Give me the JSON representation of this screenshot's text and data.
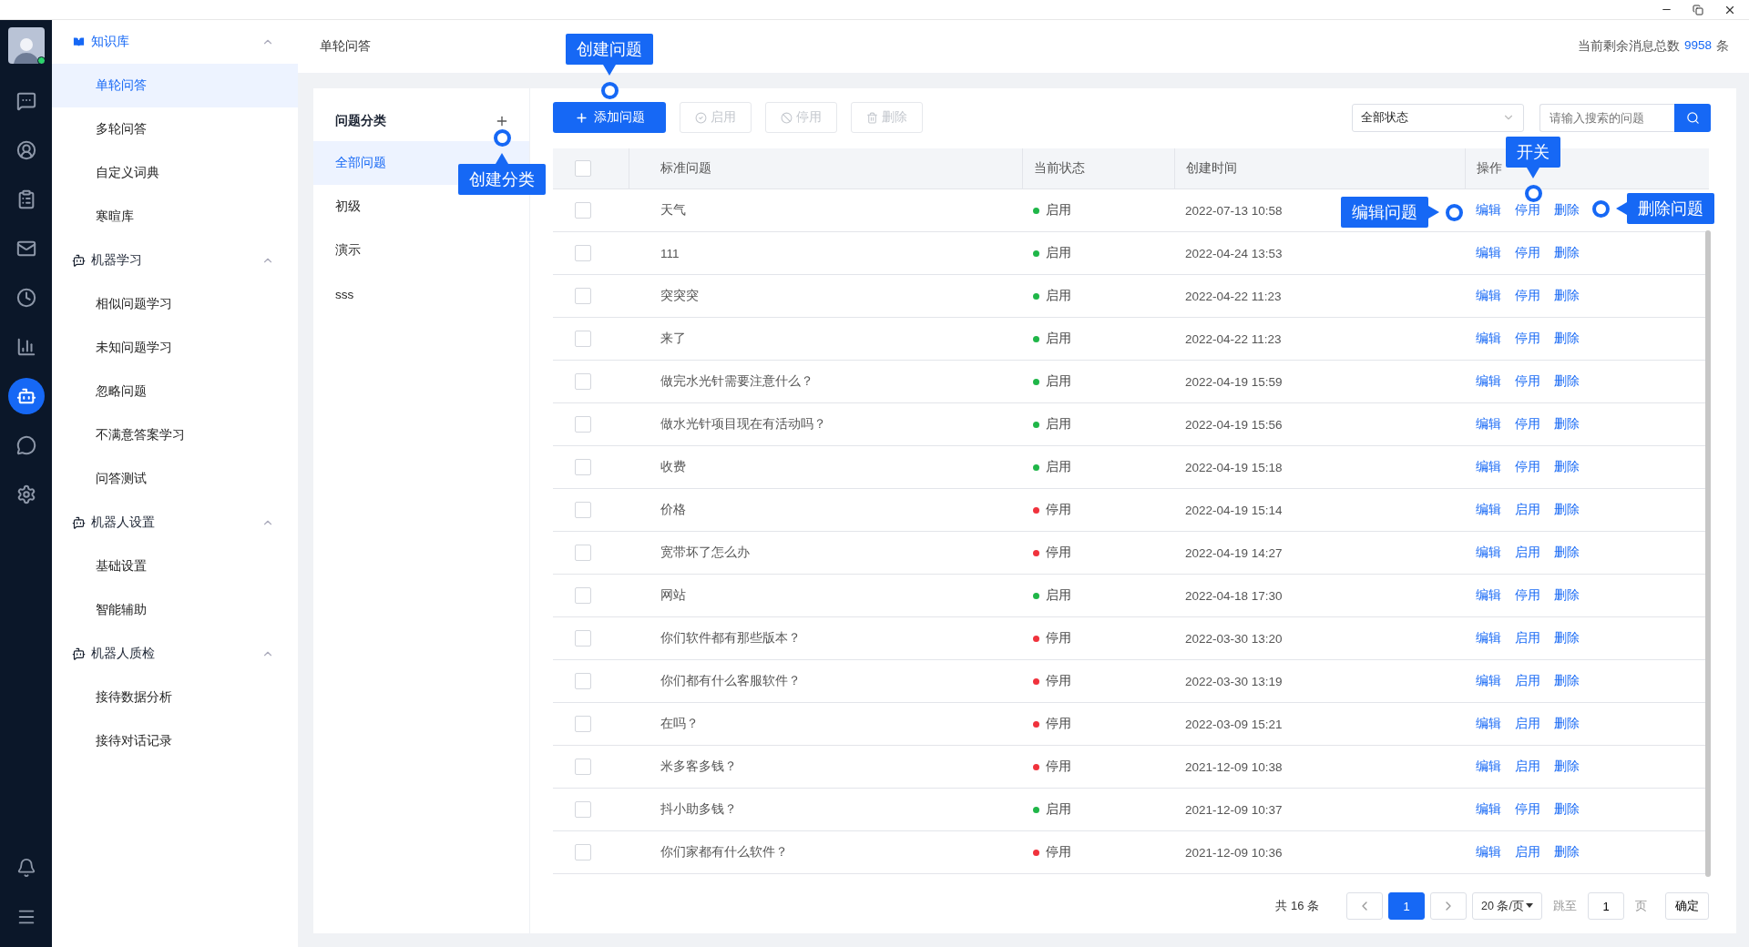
{
  "rail": {
    "items": [
      {
        "kind": "chat",
        "selected": false
      },
      {
        "kind": "user",
        "selected": false
      },
      {
        "kind": "clipboard",
        "selected": false
      },
      {
        "kind": "mail",
        "selected": false
      },
      {
        "kind": "clock",
        "selected": false
      },
      {
        "kind": "chart",
        "selected": false
      },
      {
        "kind": "robot",
        "selected": true
      },
      {
        "kind": "wechat",
        "selected": false
      },
      {
        "kind": "gear",
        "selected": false
      }
    ],
    "bottom": [
      {
        "kind": "bell"
      },
      {
        "kind": "menu"
      }
    ]
  },
  "menu": {
    "groups": [
      {
        "label": "知识库",
        "kind": "book",
        "active": true,
        "expanded": true,
        "items": [
          {
            "label": "单轮问答",
            "selected": true
          },
          {
            "label": "多轮问答",
            "selected": false
          },
          {
            "label": "自定义词典",
            "selected": false
          },
          {
            "label": "寒暄库",
            "selected": false
          }
        ]
      },
      {
        "label": "机器学习",
        "kind": "robot",
        "active": false,
        "expanded": true,
        "items": [
          {
            "label": "相似问题学习",
            "selected": false
          },
          {
            "label": "未知问题学习",
            "selected": false
          },
          {
            "label": "忽略问题",
            "selected": false
          },
          {
            "label": "不满意答案学习",
            "selected": false
          },
          {
            "label": "问答测试",
            "selected": false
          }
        ]
      },
      {
        "label": "机器人设置",
        "kind": "robot",
        "active": false,
        "expanded": true,
        "items": [
          {
            "label": "基础设置",
            "selected": false
          },
          {
            "label": "智能辅助",
            "selected": false
          }
        ]
      },
      {
        "label": "机器人质检",
        "kind": "robot",
        "active": false,
        "expanded": true,
        "items": [
          {
            "label": "接待数据分析",
            "selected": false
          },
          {
            "label": "接待对话记录",
            "selected": false
          }
        ]
      }
    ]
  },
  "header": {
    "title": "单轮问答",
    "counter_label": "当前剩余消息总数",
    "counter_value": "9958",
    "counter_unit": "条"
  },
  "categories": {
    "title": "问题分类",
    "items": [
      {
        "label": "全部问题",
        "selected": true
      },
      {
        "label": "初级",
        "selected": false
      },
      {
        "label": "演示",
        "selected": false
      },
      {
        "label": "sss",
        "selected": false
      }
    ]
  },
  "toolbar": {
    "add": "添加问题",
    "actions": [
      {
        "label": "启用",
        "kind": "enable",
        "disabled": true
      },
      {
        "label": "停用",
        "kind": "disable",
        "disabled": true
      },
      {
        "label": "删除",
        "kind": "delete",
        "disabled": true
      }
    ],
    "status_filter": "全部状态",
    "search": {
      "placeholder": "请输入搜索的问题"
    }
  },
  "table": {
    "all_checked": false,
    "columns": [
      "标准问题",
      "当前状态",
      "创建时间",
      "操作"
    ],
    "rows": [
      {
        "checked": false,
        "question": "天气",
        "status": "启用",
        "enabled": true,
        "created": "2022-07-13 10:58",
        "actions": [
          "编辑",
          "停用",
          "删除"
        ]
      },
      {
        "checked": false,
        "question": "111",
        "status": "启用",
        "enabled": true,
        "created": "2022-04-24 13:53",
        "actions": [
          "编辑",
          "停用",
          "删除"
        ]
      },
      {
        "checked": false,
        "question": "突突突",
        "status": "启用",
        "enabled": true,
        "created": "2022-04-22 11:23",
        "actions": [
          "编辑",
          "停用",
          "删除"
        ]
      },
      {
        "checked": false,
        "question": "来了",
        "status": "启用",
        "enabled": true,
        "created": "2022-04-22 11:23",
        "actions": [
          "编辑",
          "停用",
          "删除"
        ]
      },
      {
        "checked": false,
        "question": "做完水光针需要注意什么？",
        "status": "启用",
        "enabled": true,
        "created": "2022-04-19 15:59",
        "actions": [
          "编辑",
          "停用",
          "删除"
        ]
      },
      {
        "checked": false,
        "question": "做水光针项目现在有活动吗？",
        "status": "启用",
        "enabled": true,
        "created": "2022-04-19 15:56",
        "actions": [
          "编辑",
          "停用",
          "删除"
        ]
      },
      {
        "checked": false,
        "question": "收费",
        "status": "启用",
        "enabled": true,
        "created": "2022-04-19 15:18",
        "actions": [
          "编辑",
          "停用",
          "删除"
        ]
      },
      {
        "checked": false,
        "question": "价格",
        "status": "停用",
        "enabled": false,
        "created": "2022-04-19 15:14",
        "actions": [
          "编辑",
          "启用",
          "删除"
        ]
      },
      {
        "checked": false,
        "question": "宽带坏了怎么办",
        "status": "停用",
        "enabled": false,
        "created": "2022-04-19 14:27",
        "actions": [
          "编辑",
          "启用",
          "删除"
        ]
      },
      {
        "checked": false,
        "question": "网站",
        "status": "启用",
        "enabled": true,
        "created": "2022-04-18 17:30",
        "actions": [
          "编辑",
          "停用",
          "删除"
        ]
      },
      {
        "checked": false,
        "question": "你们软件都有那些版本？",
        "status": "停用",
        "enabled": false,
        "created": "2022-03-30 13:20",
        "actions": [
          "编辑",
          "启用",
          "删除"
        ]
      },
      {
        "checked": false,
        "question": "你们都有什么客服软件？",
        "status": "停用",
        "enabled": false,
        "created": "2022-03-30 13:19",
        "actions": [
          "编辑",
          "启用",
          "删除"
        ]
      },
      {
        "checked": false,
        "question": "在吗？",
        "status": "停用",
        "enabled": false,
        "created": "2022-03-09 15:21",
        "actions": [
          "编辑",
          "启用",
          "删除"
        ]
      },
      {
        "checked": false,
        "question": "米多客多钱？",
        "status": "停用",
        "enabled": false,
        "created": "2021-12-09 10:38",
        "actions": [
          "编辑",
          "启用",
          "删除"
        ]
      },
      {
        "checked": false,
        "question": "抖小助多钱？",
        "status": "启用",
        "enabled": true,
        "created": "2021-12-09 10:37",
        "actions": [
          "编辑",
          "停用",
          "删除"
        ]
      },
      {
        "checked": false,
        "question": "你们家都有什么软件？",
        "status": "停用",
        "enabled": false,
        "created": "2021-12-09 10:36",
        "actions": [
          "编辑",
          "启用",
          "删除"
        ]
      }
    ]
  },
  "pagination": {
    "total": "共 16 条",
    "pages": [
      {
        "label": "1",
        "selected": true
      }
    ],
    "page_size": "20 条/页",
    "jump_label": "跳至",
    "jump_value": "1",
    "jump_unit": "页",
    "confirm": "确定"
  },
  "callouts": [
    {
      "text": "创建问题",
      "kind": "down"
    },
    {
      "text": "创建分类",
      "kind": "up"
    },
    {
      "text": "开关",
      "kind": "down"
    },
    {
      "text": "编辑问题",
      "kind": "right"
    },
    {
      "text": "删除问题",
      "kind": "left"
    }
  ]
}
